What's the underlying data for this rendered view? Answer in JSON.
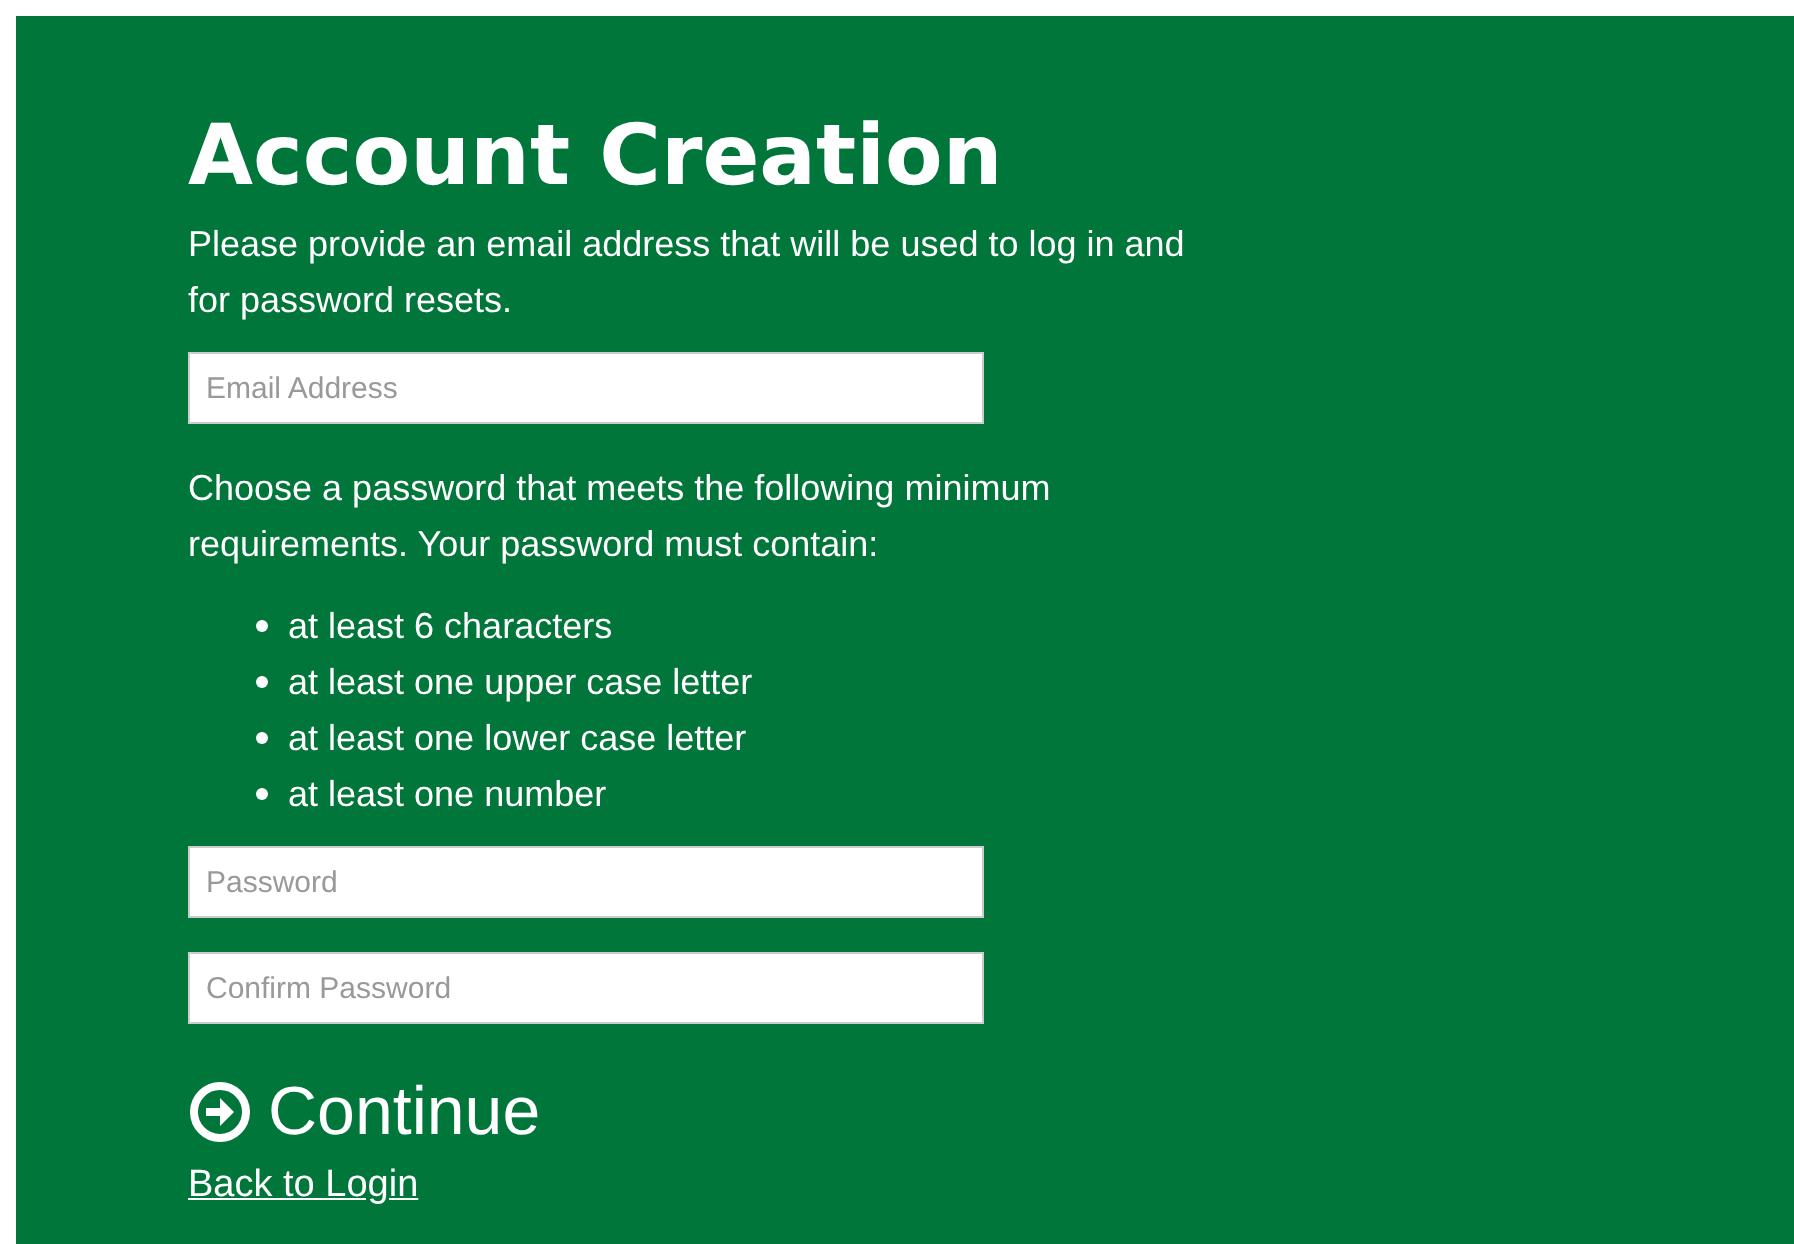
{
  "title": "Account Creation",
  "email_intro": "Please provide an email address that will be used to log in and for password resets.",
  "email_field": {
    "placeholder": "Email Address"
  },
  "password_intro": "Choose a password that meets the following minimum requirements. Your password must contain:",
  "requirements": [
    "at least 6 characters",
    "at least one upper case letter",
    "at least one lower case letter",
    "at least one number"
  ],
  "password_field": {
    "placeholder": "Password"
  },
  "confirm_field": {
    "placeholder": "Confirm Password"
  },
  "continue_button": "Continue",
  "back_link": "Back to Login"
}
